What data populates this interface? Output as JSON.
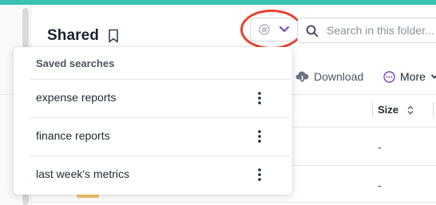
{
  "header": {
    "title": "Shared",
    "bookmark_icon": "bookmark-icon"
  },
  "saved_search_trigger": {
    "icon": "list-icon",
    "chevron_icon": "chevron-down-icon",
    "accent": "#7b3fb3",
    "highlight": "#e8412f"
  },
  "search": {
    "placeholder": "Search in this folder...",
    "value": ""
  },
  "toolbar": {
    "download_label": "Download",
    "more_label": "More"
  },
  "table": {
    "size_header": "Size",
    "rows": [
      {
        "size": "-"
      },
      {
        "size": "-"
      }
    ]
  },
  "saved_searches": {
    "heading": "Saved searches",
    "items": [
      {
        "label": "expense reports"
      },
      {
        "label": "finance reports"
      },
      {
        "label": "last week's metrics"
      }
    ]
  },
  "colors": {
    "top_bar": "#39c1b6",
    "more_icon": "#7b3fb3"
  }
}
